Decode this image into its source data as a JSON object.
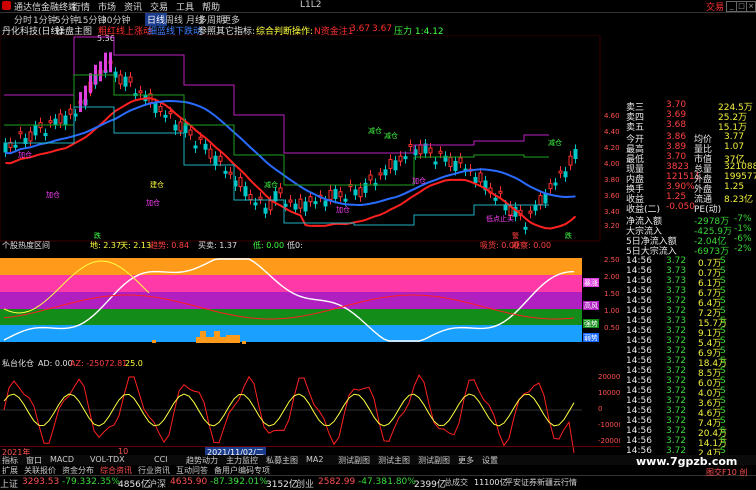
{
  "app": {
    "title": "通达信金融终端",
    "menus": [
      "行情",
      "市场",
      "资讯",
      "交易",
      "工具",
      "帮助"
    ],
    "center_code": "L1L2",
    "sell_label": "交易",
    "win_controls": [
      "_",
      "□",
      "×"
    ]
  },
  "periods": [
    "分时",
    "1分钟",
    "5分钟",
    "15分钟",
    "30分钟",
    "日线",
    "周线",
    "月线",
    "多周期",
    "更多"
  ],
  "active_period": "日线",
  "chart_header": {
    "stock": "丹化科技(日线)",
    "indicator": "操盘主图",
    "items": [
      {
        "text": "粗红线上涨动",
        "color": "#ff3030"
      },
      {
        "text": "细蓝线下跌动",
        "color": "#4080ff"
      },
      {
        "text": "参照其它指标:",
        "color": "#e0e0e0"
      },
      {
        "text": "综合判断操作:",
        "color": "#ffff40"
      },
      {
        "text": "N资金注1",
        "color": "#ff3030"
      },
      {
        "text": "3.67",
        "color": "#ff3030"
      },
      {
        "text": "3.67",
        "color": "#ff3030"
      },
      {
        "text": "压力 1:4.12",
        "color": "#40ff40"
      }
    ]
  },
  "main_chart": {
    "high_label": "5.36",
    "ymax_label": "4.60",
    "right_prices": [
      "4.60",
      "4.40",
      "4.20",
      "4.00",
      "3.80",
      "3.60",
      "3.40",
      "3.20"
    ],
    "annotations": [
      {
        "text": "加仓",
        "color": "#ff40ff"
      },
      {
        "text": "建仓",
        "color": "#ffff40"
      },
      {
        "text": "加仓",
        "color": "#ff40ff"
      },
      {
        "text": "减仓",
        "color": "#40ff40"
      },
      {
        "text": "加仓",
        "color": "#ff40ff"
      },
      {
        "text": "加仓",
        "color": "#ff40ff"
      },
      {
        "text": "减仓",
        "color": "#40ff40"
      },
      {
        "text": "低点止买",
        "color": "#ff40ff"
      },
      {
        "text": "减仓",
        "color": "#40ff40"
      },
      {
        "text": "加仓",
        "color": "#ff40ff"
      },
      {
        "text": "减仓",
        "color": "#40ff40"
      },
      {
        "text": "跌",
        "color": "#40ff40"
      },
      {
        "text": "警",
        "color": "#ff4040"
      },
      {
        "text": "跌",
        "color": "#40ff40"
      }
    ]
  },
  "osc_header": {
    "name": "个股热度区间",
    "items": [
      {
        "text": "地: 2.37",
        "color": "#ffff40"
      },
      {
        "text": "天: 2.13",
        "color": "#ffff40"
      },
      {
        "text": "趋势: 0.84",
        "color": "#ff4040"
      },
      {
        "text": "买卖: 1.37",
        "color": "#e0e0e0"
      },
      {
        "text": "低: 0.00",
        "color": "#40ff40"
      },
      {
        "text": "低0:",
        "color": "#e0e0e0"
      },
      {
        "text": "吸货: 0.00",
        "color": "#ff4040"
      },
      {
        "text": "观察: 0.00",
        "color": "#ff4040"
      }
    ],
    "scale": [
      "2.50",
      "2.00",
      "1.50",
      "1.00",
      "0.50"
    ],
    "zone_labels": [
      "暴涨",
      "高风",
      "中性",
      "强势",
      "弱势"
    ]
  },
  "bottom_header": {
    "name": "私台化仓",
    "ad": "AD: 0.00",
    "items": [
      {
        "text": "AZ: -25072.81",
        "color": "#ff4040"
      },
      {
        "text": "25.0",
        "color": "#ffff40"
      }
    ],
    "scale": [
      "20000",
      "10000",
      "0",
      "-10000",
      "-20000"
    ]
  },
  "quote": {
    "ask_rows": [
      {
        "label": "卖三",
        "price": "3.70",
        "vol": "224.5万"
      },
      {
        "label": "卖四",
        "price": "3.69",
        "vol": "25.2万"
      },
      {
        "label": "卖五",
        "price": "3.68",
        "vol": "15.1万"
      }
    ],
    "stats": [
      {
        "l": "今开",
        "v": "3.86",
        "l2": "均价",
        "v2": "3.77"
      },
      {
        "l": "最高",
        "v": "3.89",
        "l2": "量比",
        "v2": "1.07"
      },
      {
        "l": "最低",
        "v": "3.70",
        "l2": "市值",
        "v2": "37亿"
      },
      {
        "l": "现量",
        "v": "3823",
        "l2": "总量",
        "v2": "321088"
      },
      {
        "l": "内盘",
        "v": "121511",
        "l2": "外盘",
        "v2": "199577"
      },
      {
        "l": "换手",
        "v": "3.90%",
        "l2": "外盘",
        "v2": "1.25"
      },
      {
        "l": "收益",
        "v": "1.25",
        "l2": "流通",
        "v2": "8.23亿"
      },
      {
        "l": "收益(二)",
        "v": "-0.050",
        "l2": "PE(动)",
        "v2": ""
      }
    ],
    "flows": [
      {
        "l": "净流入额",
        "v": "-2978万",
        "v2": "-7%"
      },
      {
        "l": "大宗流入",
        "v": "-425.9万",
        "v2": "-1%"
      },
      {
        "l": "5日净流入额",
        "v": "-2.04亿",
        "v2": "-6%"
      },
      {
        "l": "5日大宗流入",
        "v": "-6973万",
        "v2": "-2%"
      }
    ],
    "ticks": [
      {
        "t": "14:56",
        "p": "3.72",
        "v": "0.7万",
        "s": "S"
      },
      {
        "t": "14:56",
        "p": "3.73",
        "v": "0.7万",
        "s": "S"
      },
      {
        "t": "14:56",
        "p": "3.73",
        "v": "6.1万",
        "s": "S"
      },
      {
        "t": "14:56",
        "p": "3.73",
        "v": "6.7万",
        "s": "S"
      },
      {
        "t": "14:56",
        "p": "3.72",
        "v": "6.4万",
        "s": "S"
      },
      {
        "t": "14:56",
        "p": "3.72",
        "v": "7.2万",
        "s": "S"
      },
      {
        "t": "14:56",
        "p": "3.73",
        "v": "15.7万",
        "s": "S"
      },
      {
        "t": "14:56",
        "p": "3.72",
        "v": "9.1万",
        "s": "S"
      },
      {
        "t": "14:56",
        "p": "3.72",
        "v": "5.4万",
        "s": "S"
      },
      {
        "t": "14:56",
        "p": "3.72",
        "v": "6.9万",
        "s": "S"
      },
      {
        "t": "14:56",
        "p": "3.72",
        "v": "18.4万",
        "s": "S"
      },
      {
        "t": "14:56",
        "p": "3.72",
        "v": "8.5万",
        "s": "S"
      },
      {
        "t": "14:56",
        "p": "3.72",
        "v": "6.0万",
        "s": "S"
      },
      {
        "t": "14:56",
        "p": "3.72",
        "v": "4.0万",
        "s": "S"
      },
      {
        "t": "14:56",
        "p": "3.72",
        "v": "3.6万",
        "s": "S"
      },
      {
        "t": "14:56",
        "p": "3.72",
        "v": "4.6万",
        "s": "S"
      },
      {
        "t": "14:56",
        "p": "3.72",
        "v": "7.4万",
        "s": "S"
      },
      {
        "t": "14:56",
        "p": "3.72",
        "v": "20.4万",
        "s": "S"
      },
      {
        "t": "14:56",
        "p": "3.72",
        "v": "14.1万",
        "s": "S"
      },
      {
        "t": "14:56",
        "p": "3.72",
        "v": "2.4万",
        "s": "S"
      },
      {
        "t": "14:56",
        "p": "3.72",
        "v": "3.7万",
        "s": "S"
      }
    ]
  },
  "date_axis": {
    "left": "2021年",
    "mid": "10",
    "cursor_date": "2021/11/02/二"
  },
  "tabs": [
    "指标",
    "窗口",
    "MACD",
    "VOL-TDX",
    "CCI",
    "趋势动力",
    "主力监控",
    "私募主图",
    "MA2",
    "测试副图",
    "测试主图",
    "测试副图",
    "更多",
    "设置"
  ],
  "bottom_tabs": [
    "扩展",
    "关联报价",
    "资金分布",
    "综合资讯",
    "行业资讯",
    "互动问答",
    "备用户编码专项"
  ],
  "indices": [
    {
      "name": "上证",
      "val": "3293.53",
      "chg": "-79.33",
      "pct": "-2.35%",
      "amt": "4856亿"
    },
    {
      "name": "沪深",
      "val": "4635.90",
      "chg": "-87.39",
      "pct": "-2.01%",
      "amt": "3152亿"
    },
    {
      "name": "创业",
      "val": "2582.99",
      "chg": "-47.38",
      "pct": "-1.80%",
      "amt": "2399亿"
    }
  ],
  "market_total": {
    "label": "总成交",
    "val": "11100亿",
    "tail": "平安证券新疆云行情"
  },
  "watermark": "www.7gpzb.com",
  "corner": "图交F10 创",
  "colors": {
    "up": "#ff3030",
    "down": "#00c8c8",
    "ma_red": "#ff2020",
    "ma_blue": "#2a6bff",
    "bg": "#000000"
  }
}
